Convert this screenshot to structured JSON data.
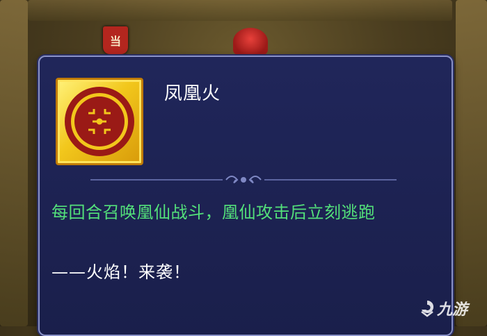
{
  "background": {
    "banner_text": "当"
  },
  "skill": {
    "name": "凤凰火",
    "description": "每回合召唤凰仙战斗，凰仙攻击后立刻逃跑",
    "quote": "——火焰！来袭！"
  },
  "watermark": {
    "text": "九游"
  },
  "colors": {
    "panel_bg": "#1c2150",
    "panel_border": "#8a92c8",
    "description_text": "#53e07a",
    "icon_gold": "#f2c71c",
    "icon_red": "#9a1a16"
  }
}
